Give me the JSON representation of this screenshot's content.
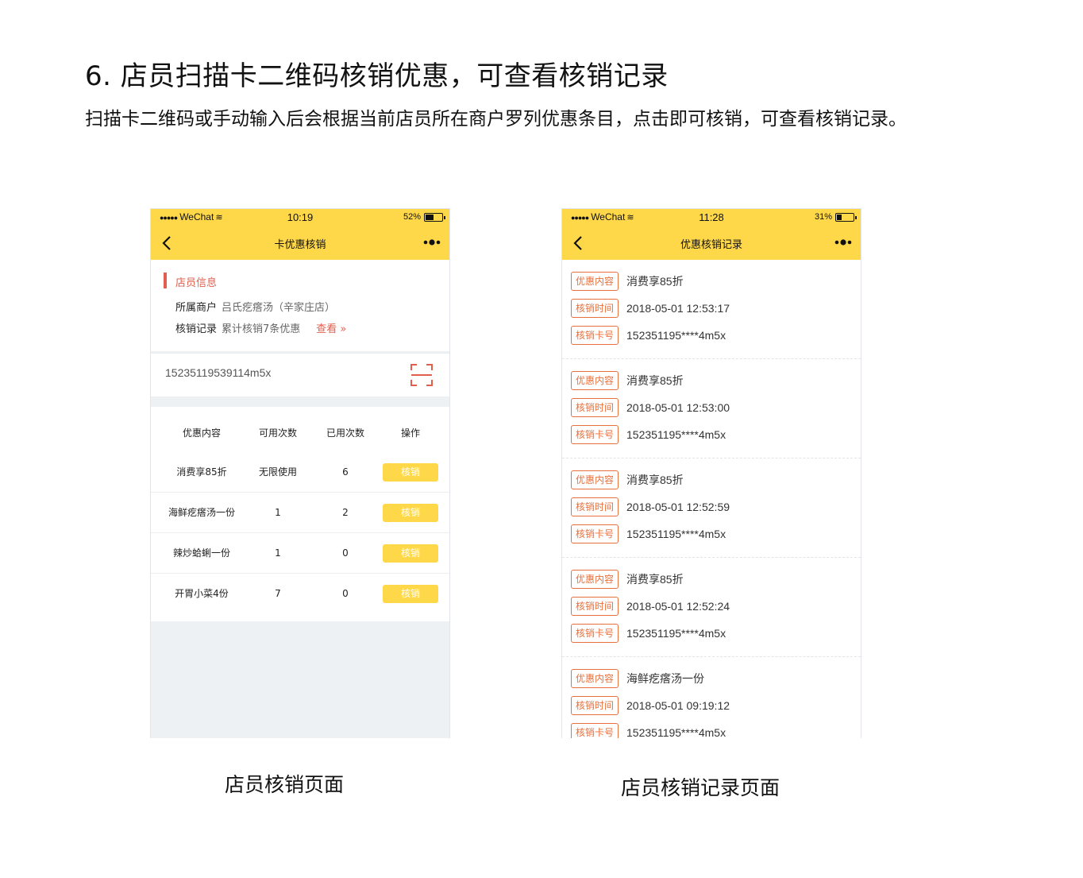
{
  "page": {
    "heading": "6. 店员扫描卡二维码核销优惠，可查看核销记录",
    "subheading": "扫描卡二维码或手动输入后会根据当前店员所在商户罗列优惠条目，点击即可核销，可查看核销记录。",
    "caption_left": "店员核销页面",
    "caption_right": "店员核销记录页面",
    "accent_color": "#ffd84a",
    "highlight_color": "#e05f4f"
  },
  "left_phone": {
    "status": {
      "carrier": "WeChat",
      "time": "10:19",
      "battery": "52%",
      "battery_level": 0.52
    },
    "nav": {
      "title": "卡优惠核销"
    },
    "staff_info": {
      "title": "店员信息",
      "merchant_label": "所属商户",
      "merchant_value": "吕氏疙瘩汤（辛家庄店）",
      "record_label": "核销记录",
      "record_value": "累计核销7条优惠",
      "view_link": "查看 »"
    },
    "card_input": {
      "value": "15235119539114m5x"
    },
    "table": {
      "headers": [
        "优惠内容",
        "可用次数",
        "已用次数",
        "操作"
      ],
      "rows": [
        {
          "content": "消费享85折",
          "available": "无限使用",
          "used": "6",
          "action": "核销"
        },
        {
          "content": "海鲜疙瘩汤一份",
          "available": "1",
          "used": "2",
          "action": "核销"
        },
        {
          "content": "辣炒蛤蜊一份",
          "available": "1",
          "used": "0",
          "action": "核销"
        },
        {
          "content": "开胃小菜4份",
          "available": "7",
          "used": "0",
          "action": "核销"
        }
      ]
    }
  },
  "right_phone": {
    "status": {
      "carrier": "WeChat",
      "time": "11:28",
      "battery": "31%",
      "battery_level": 0.31
    },
    "nav": {
      "title": "优惠核销记录"
    },
    "labels": {
      "content": "优惠内容",
      "time": "核销时间",
      "card": "核销卡号"
    },
    "records": [
      {
        "content": "消费享85折",
        "time": "2018-05-01 12:53:17",
        "card": "152351195****4m5x"
      },
      {
        "content": "消费享85折",
        "time": "2018-05-01 12:53:00",
        "card": "152351195****4m5x"
      },
      {
        "content": "消费享85折",
        "time": "2018-05-01 12:52:59",
        "card": "152351195****4m5x"
      },
      {
        "content": "消费享85折",
        "time": "2018-05-01 12:52:24",
        "card": "152351195****4m5x"
      },
      {
        "content": "海鲜疙瘩汤一份",
        "time": "2018-05-01 09:19:12",
        "card": "152351195****4m5x"
      }
    ]
  }
}
